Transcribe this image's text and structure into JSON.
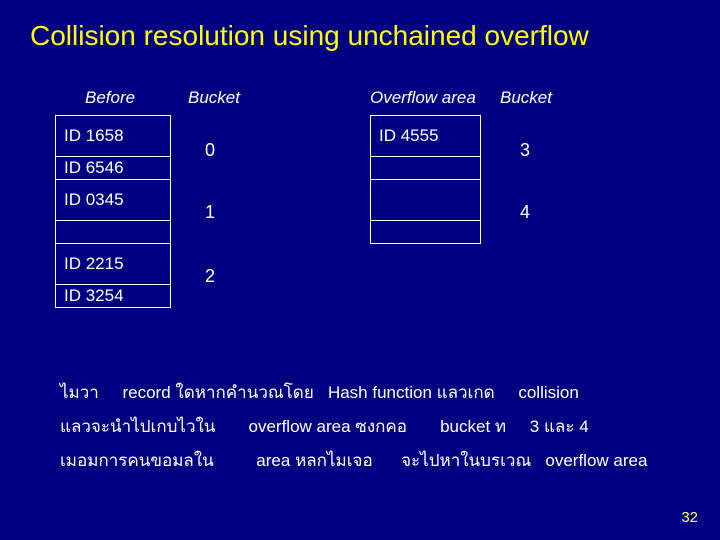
{
  "title": "Collision resolution using unchained overflow",
  "labels": {
    "before": "Before",
    "bucket_left": "Bucket",
    "overflow": "Overflow area",
    "bucket_right": "Bucket"
  },
  "left_rows": {
    "r0": "ID 1658",
    "r1": "ID 6546",
    "r2": "ID 0345",
    "r3": "",
    "r4": "ID 2215",
    "r5": "ID 3254"
  },
  "bucket_left_nums": {
    "b0": "0",
    "b1": "1",
    "b2": "2"
  },
  "right_rows": {
    "r0": "ID 4555",
    "r1": "",
    "r2": "",
    "r3": ""
  },
  "bucket_right_nums": {
    "b3": "3",
    "b4": "4"
  },
  "paragraph": {
    "l1a": "ไมวา",
    "l1b": "record",
    "l1c": "ใดหากคำนวณโดย",
    "l1d": "Hash function",
    "l1e": "แลวเกด",
    "l1f": "collision",
    "l2a": "แลวจะนำไปเกบไวใน",
    "l2b": "overflow area",
    "l2c": "ซงกคอ",
    "l2d": "bucket",
    "l2e": "ท",
    "l2f": "3",
    "l2g": "และ",
    "l2h": "4",
    "l3a": "เมอมการคนขอมลใน",
    "l3b": "area",
    "l3c": "หลกไมเจอ",
    "l3d": "จะไปหาในบรเวณ",
    "l3e": "overflow area"
  },
  "page": "32"
}
